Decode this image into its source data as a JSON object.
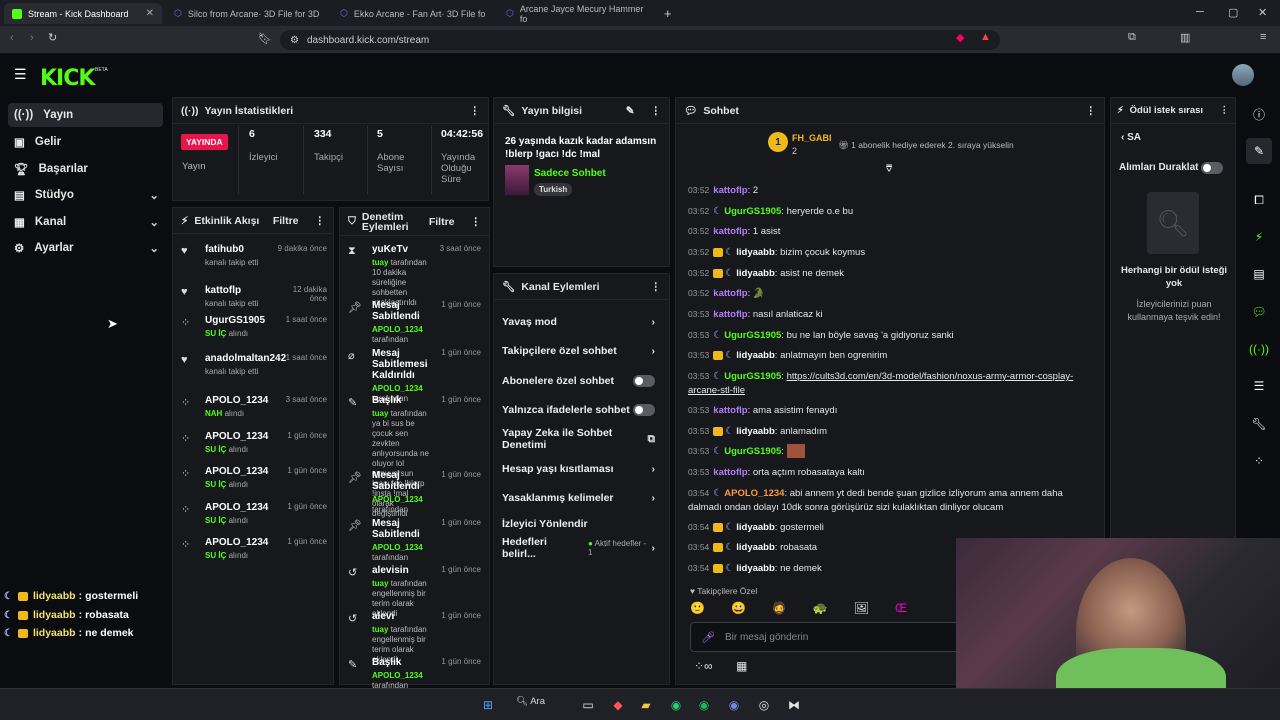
{
  "browser": {
    "tabs": [
      {
        "title": "Stream - Kick Dashboard",
        "active": true
      },
      {
        "title": "Silco from Arcane· 3D File for 3D",
        "active": false
      },
      {
        "title": "Ekko Arcane - Fan Art· 3D File fo",
        "active": false
      },
      {
        "title": "Arcane Jayce Mecury Hammer fo",
        "active": false
      }
    ],
    "url": "dashboard.kick.com/stream"
  },
  "app": {
    "logo": "KICK",
    "beta": "BETA"
  },
  "sidebar": {
    "items": [
      {
        "label": "Yayın",
        "icon": "broadcast-icon",
        "active": true
      },
      {
        "label": "Gelir",
        "icon": "wallet-icon"
      },
      {
        "label": "Başarılar",
        "icon": "trophy-icon"
      },
      {
        "label": "Stüdyo",
        "icon": "studio-icon",
        "expandable": true
      },
      {
        "label": "Kanal",
        "icon": "channel-icon",
        "expandable": true
      },
      {
        "label": "Ayarlar",
        "icon": "gear-icon",
        "expandable": true
      }
    ]
  },
  "overlay_chat": [
    {
      "user": "lidyaabb",
      "text": "gostermeli"
    },
    {
      "user": "lidyaabb",
      "text": "robasata"
    },
    {
      "user": "lidyaabb",
      "text": "ne demek"
    }
  ],
  "stats": {
    "title": "Yayın İstatistikleri",
    "live_badge": "YAYINDA",
    "live_label": "Yayın",
    "viewers": {
      "value": "6",
      "label": "İzleyici"
    },
    "followers": {
      "value": "334",
      "label": "Takipçi"
    },
    "subs": {
      "value": "5",
      "label": "Abone Sayısı"
    },
    "duration": {
      "value": "04:42:56",
      "label": "Yayında Olduğu Süre"
    }
  },
  "stream_info": {
    "title": "Yayın bilgisi",
    "stream_title": "26 yaşında kazık kadar adamsın !blerp !gacı !dc !mal",
    "category": "Sadece Sohbet",
    "tag": "Turkish"
  },
  "activity": {
    "title": "Etkinlik Akışı",
    "filter": "Filtre",
    "items": [
      {
        "icon": "heart-icon",
        "user": "fatihub0",
        "sub": "kanalı takip etti",
        "time": "9 dakika önce"
      },
      {
        "icon": "heart-icon",
        "user": "kattoflp",
        "sub": "kanalı takip etti",
        "time": "12 dakika önce"
      },
      {
        "icon": "kick-icon",
        "user": "UgurGS1905",
        "reward": "SU İÇ",
        "rcolor": "grn",
        "sub": "alındı",
        "time": "1 saat önce"
      },
      {
        "icon": "heart-icon",
        "user": "anadolmaltan242",
        "sub": "kanalı takip etti",
        "time": "1 saat önce"
      },
      {
        "icon": "kick-icon",
        "user": "APOLO_1234",
        "reward": "NAH",
        "rcolor": "grn",
        "sub": "alındı",
        "time": "3 saat önce"
      },
      {
        "icon": "kick-icon",
        "user": "APOLO_1234",
        "reward": "SU İÇ",
        "rcolor": "grn",
        "sub": "alındı",
        "time": "1 gün önce"
      },
      {
        "icon": "kick-icon",
        "user": "APOLO_1234",
        "reward": "SU İÇ",
        "rcolor": "grn",
        "sub": "alındı",
        "time": "1 gün önce"
      },
      {
        "icon": "kick-icon",
        "user": "APOLO_1234",
        "reward": "SU İÇ",
        "rcolor": "grn",
        "sub": "alındı",
        "time": "1 gün önce"
      },
      {
        "icon": "kick-icon",
        "user": "APOLO_1234",
        "reward": "SU İÇ",
        "rcolor": "grn",
        "sub": "alındı",
        "time": "1 gün önce"
      }
    ]
  },
  "moderation": {
    "title": "Denetim Eylemleri",
    "filter": "Filtre",
    "items": [
      {
        "icon": "hourglass-icon",
        "title": "yuKeTv",
        "actor": "tuay",
        "rest": "tarafından 10 dakika süreliğine sohbetten uzaklaştırıldı",
        "time": "3 saat önce"
      },
      {
        "icon": "pin-icon",
        "title": "Mesaj Sabitlendi",
        "actor": "APOLO_1234",
        "rest": "tarafından",
        "time": "1 gün önce"
      },
      {
        "icon": "unpin-icon",
        "title": "Mesaj Sabitlemesi Kaldırıldı",
        "actor": "APOLO_1234",
        "rest": "tarafından",
        "time": "1 gün önce"
      },
      {
        "icon": "title-icon",
        "title": "Başlık",
        "actor": "tuay",
        "rest": "tarafından ya bi sus be çocuk sen zevkten anlıyorsunda ne oluyor lol oynuyorsun !gacı !dc !blerp !insta !mal olarak değiştirildi",
        "time": "1 gün önce"
      },
      {
        "icon": "pin-icon",
        "title": "Mesaj Sabitlendi",
        "actor": "APOLO_1234",
        "rest": "tarafından",
        "time": "1 gün önce"
      },
      {
        "icon": "pin-icon",
        "title": "Mesaj Sabitlendi",
        "actor": "APOLO_1234",
        "rest": "tarafından",
        "time": "1 gün önce"
      },
      {
        "icon": "undo-icon",
        "title": "alevisin",
        "actor": "tuay",
        "rest": "tarafından engellenmiş bir terim olarak eklendi",
        "time": "1 gün önce"
      },
      {
        "icon": "undo-icon",
        "title": "alevi",
        "actor": "tuay",
        "rest": "tarafından engellenmiş bir terim olarak eklendi",
        "time": "1 gün önce"
      },
      {
        "icon": "title-icon",
        "title": "Başlık",
        "actor": "APOLO_1234",
        "rest": "tarafından",
        "time": "1 gün önce"
      }
    ]
  },
  "channel_actions": {
    "title": "Kanal Eylemleri",
    "items": [
      {
        "label": "Yavaş mod",
        "control": "chevron"
      },
      {
        "label": "Takipçilere özel sohbet",
        "control": "chevron"
      },
      {
        "label": "Abonelere özel sohbet",
        "control": "toggle"
      },
      {
        "label": "Yalnızca ifadelerle sohbet",
        "control": "toggle"
      },
      {
        "label": "Yapay Zeka ile Sohbet Denetimi",
        "control": "external"
      },
      {
        "label": "Hesap yaşı kısıtlaması",
        "control": "chevron"
      },
      {
        "label": "Yasaklanmış kelimeler",
        "control": "chevron"
      },
      {
        "label": "İzleyici Yönlendir",
        "control": "none"
      },
      {
        "label": "Hedefleri belirl...",
        "extra": "Aktif hedefler - 1",
        "control": "chevron"
      }
    ]
  },
  "chat": {
    "title": "Sohbet",
    "pinned_user": "FH_GABI",
    "pinned_count": "2",
    "gift_text": "1 abonelik hediye ederek 2. sıraya yükselin",
    "messages": [
      {
        "time": "03:52",
        "user": "kattoflp",
        "color": "#b57cff",
        "text": "2",
        "badges": ""
      },
      {
        "time": "03:52",
        "user": "UgurGS1905",
        "color": "#53fc18",
        "text": "heryerde o.e bu",
        "badges": "moon"
      },
      {
        "time": "03:52",
        "user": "kattoflp",
        "color": "#b57cff",
        "text": "1 asist",
        "badges": ""
      },
      {
        "time": "03:52",
        "user": "lidyaabb",
        "color": "#ffffff",
        "text": "bizim çocuk koymus",
        "badges": "crown-moon"
      },
      {
        "time": "03:52",
        "user": "lidyaabb",
        "color": "#ffffff",
        "text": "asist ne demek",
        "badges": "crown-moon"
      },
      {
        "time": "03:52",
        "user": "kattoflp",
        "color": "#b57cff",
        "text": "🐊",
        "badges": ""
      },
      {
        "time": "03:53",
        "user": "kattoflp",
        "color": "#b57cff",
        "text": "nasıl anlaticaz ki",
        "badges": ""
      },
      {
        "time": "03:53",
        "user": "UgurGS1905",
        "color": "#53fc18",
        "text": "bu ne lan böyle savaş 'a gidiyoruz sanki",
        "badges": "moon"
      },
      {
        "time": "03:53",
        "user": "lidyaabb",
        "color": "#ffffff",
        "text": "anlatmayın ben ogrenirim",
        "badges": "crown-moon"
      },
      {
        "time": "03:53",
        "user": "UgurGS1905",
        "color": "#53fc18",
        "text": "https://cults3d.com/en/3d-model/fashion/noxus-army-armor-cosplay-arcane-stl-file",
        "badges": "moon",
        "link": true
      },
      {
        "time": "03:53",
        "user": "kattoflp",
        "color": "#b57cff",
        "text": "ama asistim fenaydı",
        "badges": ""
      },
      {
        "time": "03:53",
        "user": "lidyaabb",
        "color": "#ffffff",
        "text": "anlamadım",
        "badges": "crown-moon"
      },
      {
        "time": "03:53",
        "user": "UgurGS1905",
        "color": "#53fc18",
        "text": "",
        "badges": "moon",
        "emote": true
      },
      {
        "time": "03:53",
        "user": "kattoflp",
        "color": "#b57cff",
        "text": "orta açtım robasataya kaltı",
        "badges": ""
      },
      {
        "time": "03:54",
        "user": "APOLO_1234",
        "color": "#ff9a3c",
        "text": "abi annem yt dedi bende şuan gizlice izliyorum ama annem daha dalmadı ondan dolayı 10dk sonra görüşürüz sizi kulaklıktan dinliyor olucam",
        "badges": "moon"
      },
      {
        "time": "03:54",
        "user": "lidyaabb",
        "color": "#ffffff",
        "text": "gostermeli",
        "badges": "crown-moon"
      },
      {
        "time": "03:54",
        "user": "lidyaabb",
        "color": "#ffffff",
        "text": "robasata",
        "badges": "crown-moon"
      },
      {
        "time": "03:54",
        "user": "lidyaabb",
        "color": "#ffffff",
        "text": "ne demek",
        "badges": "crown-moon"
      }
    ],
    "followers_only": "Takipçilere Özel",
    "placeholder": "Bir mesaj gönderin"
  },
  "rewards": {
    "title": "Ödül istek sırası",
    "back_label": "SA",
    "pause_label": "Alımları Duraklat",
    "empty_title": "Herhangi bir ödül isteği yok",
    "empty_sub": "İzleyicilerinizi puan kullanmaya teşvik edin!"
  },
  "taskbar": {
    "search": "Ara"
  },
  "colors": {
    "accent": "#53fc18",
    "live": "#e8144b",
    "bg": "#0b0c0f",
    "panel": "#17181c"
  }
}
